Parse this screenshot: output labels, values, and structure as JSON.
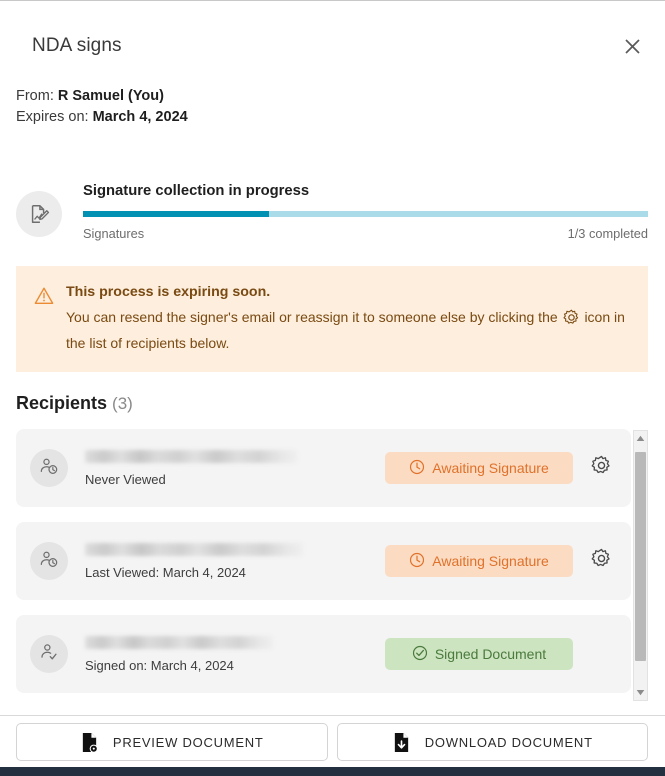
{
  "dialog": {
    "title": "NDA signs",
    "close_icon": "close-icon"
  },
  "meta": {
    "from_label": "From:",
    "from_value": "R Samuel (You)",
    "expires_label": "Expires on:",
    "expires_value": "March 4, 2024"
  },
  "progress": {
    "icon": "document-signature-icon",
    "title": "Signature collection in progress",
    "label": "Signatures",
    "completed_text": "1/3 completed",
    "completed": 1,
    "total": 3,
    "percent": 33,
    "fill_color": "#0091b3",
    "track_color": "#aadbe8"
  },
  "warning": {
    "icon": "warning-triangle-icon",
    "inline_icon": "gear-icon",
    "title": "This process is expiring soon.",
    "body_before": "You can resend the signer's email or reassign it to someone else by clicking the",
    "body_after": "icon in the list of recipients below.",
    "background_color": "#fdeedd",
    "text_color": "#7a4a12"
  },
  "recipients": {
    "heading": "Recipients",
    "count_text": "(3)",
    "count": 3,
    "rows": [
      {
        "avatar_icon": "user-clock-icon",
        "email": "",
        "email_redacted": true,
        "sub": "Never Viewed",
        "status": "Awaiting Signature",
        "status_type": "awaiting",
        "status_icon": "clock-icon",
        "gear_icon": "gear-icon",
        "has_gear": true
      },
      {
        "avatar_icon": "user-clock-icon",
        "email": "",
        "email_redacted": true,
        "sub": "Last Viewed: March 4, 2024",
        "status": "Awaiting Signature",
        "status_type": "awaiting",
        "status_icon": "clock-icon",
        "gear_icon": "gear-icon",
        "has_gear": true
      },
      {
        "avatar_icon": "user-check-icon",
        "email": "",
        "email_redacted": true,
        "sub": "Signed on: March 4, 2024",
        "status": "Signed Document",
        "status_type": "signed",
        "status_icon": "check-circle-icon",
        "gear_icon": "",
        "has_gear": false
      }
    ],
    "badge_colors": {
      "awaiting_bg": "#fbdcc3",
      "awaiting_fg": "#e0712a",
      "signed_bg": "#cde4c1",
      "signed_fg": "#4a7a3c"
    }
  },
  "scrollbar": {
    "up_icon": "chevron-up-icon",
    "down_icon": "chevron-down-icon"
  },
  "footer": {
    "preview_label": "PREVIEW DOCUMENT",
    "preview_icon": "document-preview-icon",
    "download_label": "DOWNLOAD DOCUMENT",
    "download_icon": "document-download-icon"
  }
}
